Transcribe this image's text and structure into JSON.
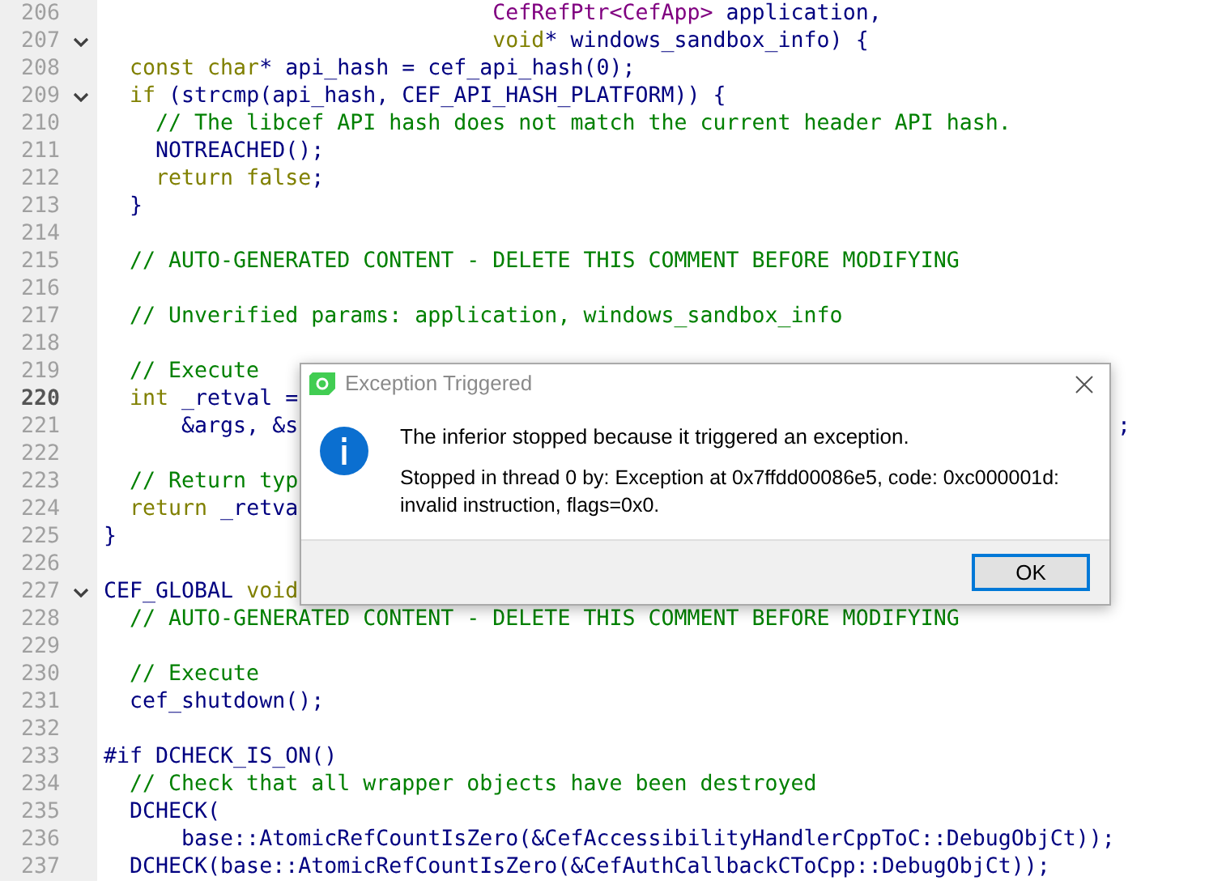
{
  "editor": {
    "lines": [
      {
        "number": "206",
        "tokens": [
          {
            "text": "                              CefRefPtr<CefApp>",
            "kind": "type"
          },
          {
            "text": " application,",
            "kind": "plain"
          }
        ]
      },
      {
        "number": "207",
        "foldable": true,
        "tokens": [
          {
            "text": "                              void",
            "kind": "keyword"
          },
          {
            "text": "* windows_sandbox_info) {",
            "kind": "plain"
          }
        ]
      },
      {
        "number": "208",
        "tokens": [
          {
            "text": "  const char",
            "kind": "keyword"
          },
          {
            "text": "* api_hash = cef_api_hash(0);",
            "kind": "plain"
          }
        ]
      },
      {
        "number": "209",
        "foldable": true,
        "tokens": [
          {
            "text": "  if",
            "kind": "keyword"
          },
          {
            "text": " (strcmp(api_hash, CEF_API_HASH_PLATFORM)) {",
            "kind": "plain"
          }
        ]
      },
      {
        "number": "210",
        "tokens": [
          {
            "text": "    // The libcef API hash does not match the current header API hash.",
            "kind": "comment"
          }
        ]
      },
      {
        "number": "211",
        "tokens": [
          {
            "text": "    NOTREACHED();",
            "kind": "plain"
          }
        ]
      },
      {
        "number": "212",
        "tokens": [
          {
            "text": "    return false",
            "kind": "keyword"
          },
          {
            "text": ";",
            "kind": "plain"
          }
        ]
      },
      {
        "number": "213",
        "tokens": [
          {
            "text": "  }",
            "kind": "plain"
          }
        ]
      },
      {
        "number": "214"
      },
      {
        "number": "215",
        "tokens": [
          {
            "text": "  // AUTO-GENERATED CONTENT - DELETE THIS COMMENT BEFORE MODIFYING",
            "kind": "comment"
          }
        ]
      },
      {
        "number": "216"
      },
      {
        "number": "217",
        "tokens": [
          {
            "text": "  // Unverified params: application, windows_sandbox_info",
            "kind": "comment"
          }
        ]
      },
      {
        "number": "218"
      },
      {
        "number": "219",
        "tokens": [
          {
            "text": "  // Execute",
            "kind": "comment"
          }
        ]
      },
      {
        "number": "220",
        "current": true,
        "tokens": [
          {
            "text": "  int",
            "kind": "keyword"
          },
          {
            "text": " _retval =",
            "kind": "plain"
          }
        ]
      },
      {
        "number": "221",
        "tokens": [
          {
            "text": "      &args, &s",
            "kind": "plain"
          }
        ],
        "tail": ";"
      },
      {
        "number": "222"
      },
      {
        "number": "223",
        "tokens": [
          {
            "text": "  // Return typ",
            "kind": "comment"
          }
        ]
      },
      {
        "number": "224",
        "tokens": [
          {
            "text": "  return",
            "kind": "keyword"
          },
          {
            "text": " _retva",
            "kind": "plain"
          }
        ]
      },
      {
        "number": "225",
        "tokens": [
          {
            "text": "}",
            "kind": "plain"
          }
        ]
      },
      {
        "number": "226"
      },
      {
        "number": "227",
        "foldable": true,
        "tokens": [
          {
            "text": "CEF_GLOBAL ",
            "kind": "plain"
          },
          {
            "text": "void",
            "kind": "keyword"
          }
        ]
      },
      {
        "number": "228",
        "tokens": [
          {
            "text": "  // AUTO-GENERATED CONTENT - DELETE THIS COMMENT BEFORE MODIFYING",
            "kind": "comment"
          }
        ]
      },
      {
        "number": "229"
      },
      {
        "number": "230",
        "tokens": [
          {
            "text": "  // Execute",
            "kind": "comment"
          }
        ]
      },
      {
        "number": "231",
        "tokens": [
          {
            "text": "  cef_shutdown();",
            "kind": "plain"
          }
        ]
      },
      {
        "number": "232"
      },
      {
        "number": "233",
        "tokens": [
          {
            "text": "#if DCHECK_IS_ON()",
            "kind": "plain"
          }
        ]
      },
      {
        "number": "234",
        "tokens": [
          {
            "text": "  // Check that all wrapper objects have been destroyed",
            "kind": "comment"
          }
        ]
      },
      {
        "number": "235",
        "tokens": [
          {
            "text": "  DCHECK(",
            "kind": "plain"
          }
        ]
      },
      {
        "number": "236",
        "tokens": [
          {
            "text": "      base::AtomicRefCountIsZero(&CefAccessibilityHandlerCppToC::DebugObjCt));",
            "kind": "plain"
          }
        ]
      },
      {
        "number": "237",
        "tokens": [
          {
            "text": "  DCHECK(base::AtomicRefCountIsZero(&CefAuthCallbackCToCpp::DebugObjCt));",
            "kind": "plain"
          }
        ]
      }
    ]
  },
  "dialog": {
    "title": "Exception Triggered",
    "message": "The inferior stopped because it triggered an exception.",
    "details": "Stopped in thread 0 by: Exception at 0x7ffdd00086e5, code: 0xc000001d: invalid instruction, flags=0x0.",
    "buttons": [
      {
        "label": "OK",
        "selected": true
      }
    ]
  }
}
